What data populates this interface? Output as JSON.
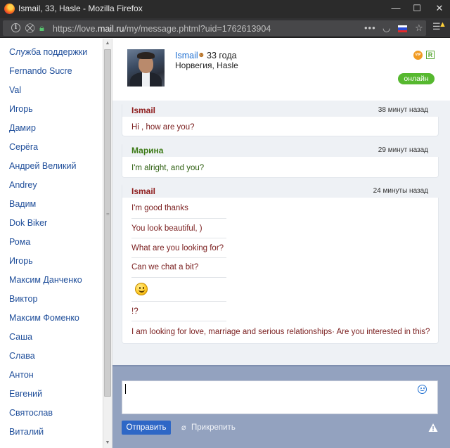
{
  "window": {
    "title": "Ismail, 33, Hasle - Mozilla Firefox",
    "minimize": "—",
    "maximize": "☐",
    "close": "✕"
  },
  "navbar": {
    "url_prefix": "https://love.",
    "url_domain": "mail.ru",
    "url_path": "/my/message.phtml?uid=1762613904",
    "icons": [
      "info-icon",
      "tracking-protection-icon",
      "lock-icon",
      "page-actions-icon",
      "pocket-icon",
      "russian-flag-icon",
      "bookmark-star-icon",
      "hamburger-menu-icon",
      "update-warning-icon"
    ]
  },
  "contacts": [
    "Служба поддержки",
    "Fernando Sucre",
    "Val",
    "Игорь",
    "Дамир",
    "Серёга",
    "Андрей Великий",
    "Andrey",
    "Вадим",
    "Dok Biker",
    "Рома",
    "Игорь",
    "Максим Данченко",
    "Виктор",
    "Максим Фоменко",
    "Саша",
    "Слава",
    "Антон",
    "Евгений",
    "Святослав",
    "Виталий"
  ],
  "profile": {
    "name": "Ismail",
    "age": "33 года",
    "location": "Норвегия, Hasle",
    "status": "онлайн",
    "vip_label": "VIP",
    "r_label": "R"
  },
  "messages": [
    {
      "author": "Ismail",
      "time": "38 минут назад",
      "lines": [
        "Hi , how are you?"
      ]
    },
    {
      "author": "Марина",
      "time": "29 минут назад",
      "lines": [
        "I'm alright, and you?"
      ]
    },
    {
      "author": "Ismail",
      "time": "24 минуты назад",
      "lines": [
        "I'm good thanks",
        "You look beautiful, )",
        "What are you looking for?",
        "Can we chat a bit?",
        "!?",
        "I am looking for love, marriage and serious relationships· Are you interested in this?"
      ]
    }
  ],
  "compose": {
    "input_value": "",
    "send_label": "Отправить",
    "attach_label": "Прикрепить"
  },
  "colors": {
    "him": "#8e1c1c",
    "her": "#3c7a16",
    "link": "#1f6fd1",
    "online": "#56b82f",
    "compose_bg": "#93a2bf",
    "send_button": "#2e67c6"
  }
}
